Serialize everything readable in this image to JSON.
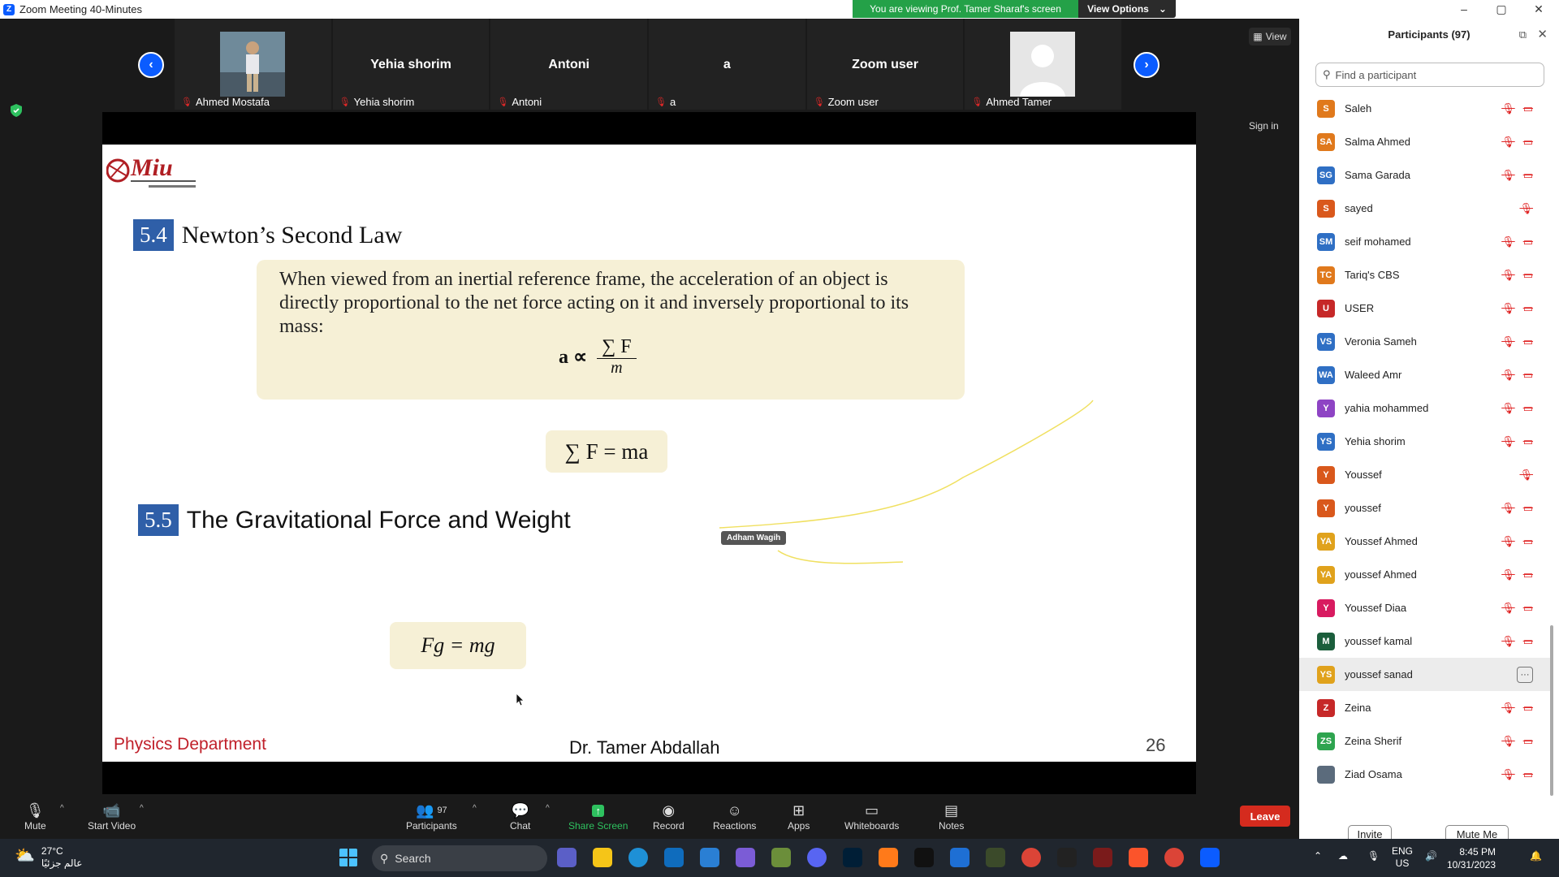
{
  "window": {
    "title": "Zoom Meeting 40-Minutes",
    "banner": "You are viewing Prof. Tamer Sharaf's screen",
    "view_options": "View Options",
    "min": "–",
    "max": "▢",
    "close": "✕"
  },
  "gallery": {
    "tiles": [
      {
        "name": "Ahmed Mostafa",
        "big": "",
        "photo": true
      },
      {
        "name": "Yehia shorim",
        "big": "Yehia shorim",
        "photo": false
      },
      {
        "name": "Antoni",
        "big": "Antoni",
        "photo": false
      },
      {
        "name": "a",
        "big": "a",
        "photo": false
      },
      {
        "name": "Zoom user",
        "big": "Zoom user",
        "photo": false
      },
      {
        "name": "Ahmed Tamer",
        "big": "",
        "photo": true
      }
    ],
    "prev": "‹",
    "next": "›",
    "view": "View",
    "sign_in": "Sign in"
  },
  "slide": {
    "sec1_num": "5.4",
    "sec1_title": "Newton’s Second Law",
    "law_text": "When viewed from an inertial reference frame, the acceleration of an object is directly proportional to the net force acting on it and inversely proportional to its mass:",
    "eq1_lhs": "a ∝",
    "eq1_num": "∑ F",
    "eq1_den": "m",
    "eq2": "∑ F = ma",
    "sec2_num": "5.5",
    "sec2_title": "The Gravitational Force and Weight",
    "eq3": "Fg = mg",
    "annotator": "Adham Wagih",
    "department": "Physics Department",
    "professor": "Dr. Tamer Abdallah",
    "page": "26",
    "logo_text": "Miu"
  },
  "participants_panel": {
    "title": "Participants (97)",
    "search_placeholder": "Find a participant",
    "invite": "Invite",
    "mute_me": "Mute Me",
    "people": [
      {
        "initials": "S",
        "name": "Saleh",
        "color": "#e0791c",
        "video_off": true
      },
      {
        "initials": "SA",
        "name": "Salma Ahmed",
        "color": "#e0791c",
        "video_off": true
      },
      {
        "initials": "SG",
        "name": "Sama Garada",
        "color": "#2f6fc4",
        "video_off": true
      },
      {
        "initials": "S",
        "name": "sayed",
        "color": "#d9581c",
        "video_off": false
      },
      {
        "initials": "SM",
        "name": "seif mohamed",
        "color": "#2f6fc4",
        "video_off": true
      },
      {
        "initials": "TC",
        "name": "Tariq's CBS",
        "color": "#e0791c",
        "video_off": true
      },
      {
        "initials": "U",
        "name": "USER",
        "color": "#c62828",
        "video_off": true
      },
      {
        "initials": "VS",
        "name": "Veronia Sameh",
        "color": "#2f6fc4",
        "video_off": true
      },
      {
        "initials": "WA",
        "name": "Waleed Amr",
        "color": "#2f6fc4",
        "video_off": true
      },
      {
        "initials": "Y",
        "name": "yahia mohammed",
        "color": "#8e44c4",
        "video_off": true
      },
      {
        "initials": "YS",
        "name": "Yehia shorim",
        "color": "#2f6fc4",
        "video_off": true
      },
      {
        "initials": "Y",
        "name": "Youssef",
        "color": "#d9581c",
        "video_off": false
      },
      {
        "initials": "Y",
        "name": "youssef",
        "color": "#d9581c",
        "video_off": true
      },
      {
        "initials": "YA",
        "name": "Youssef Ahmed",
        "color": "#e0a21c",
        "video_off": true
      },
      {
        "initials": "YA",
        "name": "youssef Ahmed",
        "color": "#e0a21c",
        "video_off": true
      },
      {
        "initials": "Y",
        "name": "Youssef Diaa",
        "color": "#d81b60",
        "video_off": true
      },
      {
        "initials": "M",
        "name": "youssef kamal",
        "color": "#1b5e3c",
        "video_off": true
      },
      {
        "initials": "YS",
        "name": "youssef sanad",
        "color": "#e0a21c",
        "video_off": false,
        "selected": true
      },
      {
        "initials": "Z",
        "name": "Zeina",
        "color": "#c62828",
        "video_off": true
      },
      {
        "initials": "ZS",
        "name": "Zeina Sherif",
        "color": "#2ea44f",
        "video_off": true
      },
      {
        "initials": "",
        "name": "Ziad Osama",
        "color": "#5b6b7c",
        "video_off": true
      }
    ]
  },
  "toolbar": {
    "mute": "Mute",
    "start_video": "Start Video",
    "participants": "Participants",
    "participants_count": "97",
    "chat": "Chat",
    "share": "Share Screen",
    "record": "Record",
    "reactions": "Reactions",
    "apps": "Apps",
    "whiteboards": "Whiteboards",
    "notes": "Notes",
    "leave": "Leave"
  },
  "taskbar": {
    "temp": "27°C",
    "weather_text": "عالم جزئيًا",
    "search": "Search",
    "lang1": "ENG",
    "lang2": "US",
    "time": "8:45 PM",
    "date": "10/31/2023"
  }
}
